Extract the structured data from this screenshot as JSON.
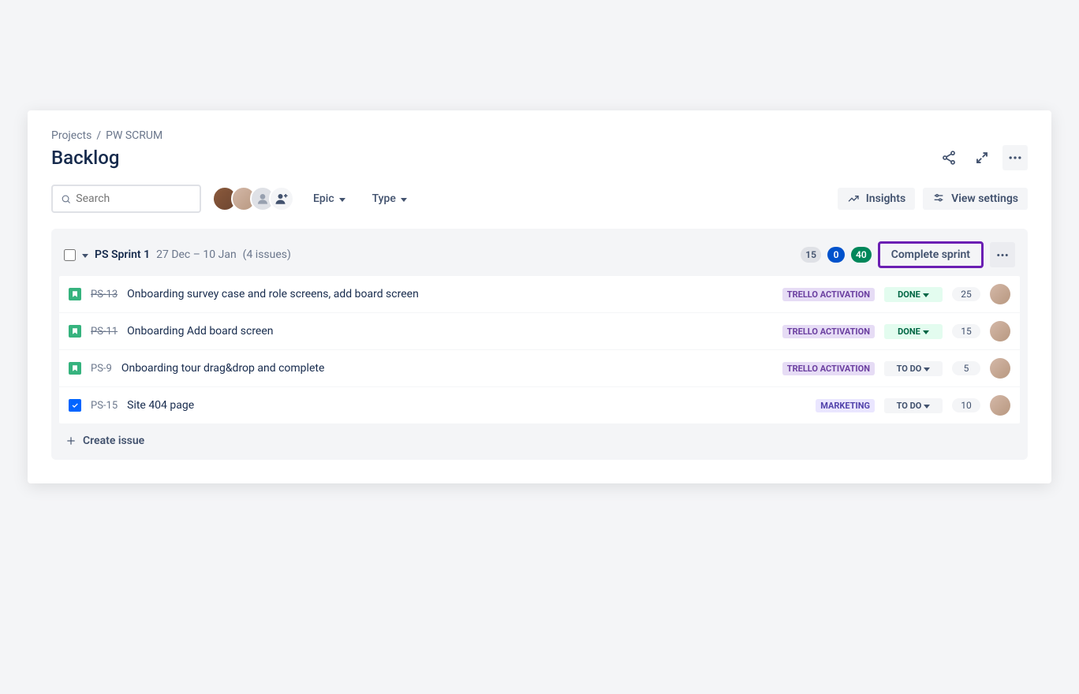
{
  "breadcrumb": {
    "root": "Projects",
    "project": "PW SCRUM"
  },
  "page": {
    "title": "Backlog"
  },
  "search": {
    "placeholder": "Search"
  },
  "filters": {
    "epic": "Epic",
    "type": "Type"
  },
  "toolbar": {
    "insights": "Insights",
    "view_settings": "View settings"
  },
  "sprint": {
    "name": "PS Sprint 1",
    "dates": "27 Dec – 10 Jan",
    "issue_count": "(4 issues)",
    "counts": {
      "todo": "15",
      "inprogress": "0",
      "done": "40"
    },
    "complete_label": "Complete sprint"
  },
  "issues": [
    {
      "key": "PS-13",
      "title": "Onboarding survey case and role screens, add board screen",
      "epic": "TRELLO ACTIVATION",
      "status": "DONE",
      "status_type": "done",
      "points": "25",
      "done": true,
      "type": "story"
    },
    {
      "key": "PS-11",
      "title": "Onboarding Add board screen",
      "epic": "TRELLO ACTIVATION",
      "status": "DONE",
      "status_type": "done",
      "points": "15",
      "done": true,
      "type": "story"
    },
    {
      "key": "PS-9",
      "title": "Onboarding tour drag&drop and complete",
      "epic": "TRELLO ACTIVATION",
      "status": "TO DO",
      "status_type": "todo",
      "points": "5",
      "done": false,
      "type": "story"
    },
    {
      "key": "PS-15",
      "title": "Site 404 page",
      "epic": "MARKETING",
      "status": "TO DO",
      "status_type": "todo",
      "points": "10",
      "done": false,
      "type": "task"
    }
  ],
  "create_issue": "Create issue"
}
